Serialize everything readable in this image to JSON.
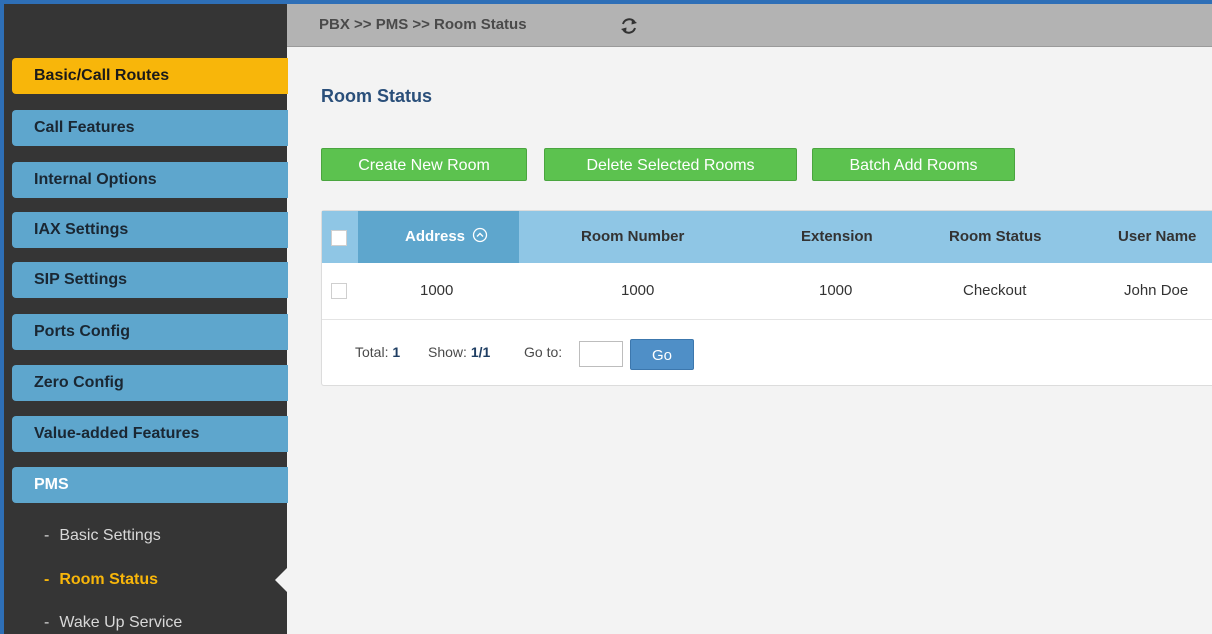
{
  "header": {
    "breadcrumb": "PBX >> PMS >> Room Status",
    "refresh_icon": "refresh-icon"
  },
  "sidebar": {
    "items": [
      {
        "label": "Basic/Call Routes",
        "state": "active"
      },
      {
        "label": "Call Features"
      },
      {
        "label": "Internal Options"
      },
      {
        "label": "IAX Settings"
      },
      {
        "label": "SIP Settings"
      },
      {
        "label": "Ports Config"
      },
      {
        "label": "Zero Config"
      },
      {
        "label": "Value-added Features"
      },
      {
        "label": "PMS",
        "state": "open"
      }
    ],
    "sub_items": [
      {
        "label": "Basic Settings"
      },
      {
        "label": "Room Status",
        "state": "current"
      },
      {
        "label": "Wake Up Service"
      }
    ],
    "sub_dash": "-"
  },
  "main": {
    "title": "Room Status",
    "buttons": {
      "create": "Create New Room",
      "delete": "Delete Selected Rooms",
      "batch": "Batch Add Rooms"
    },
    "table": {
      "columns": [
        "Address",
        "Room Number",
        "Extension",
        "Room Status",
        "User Name"
      ],
      "sorted_column": "Address",
      "rows": [
        [
          "1000",
          "1000",
          "1000",
          "Checkout",
          "John Doe"
        ]
      ]
    },
    "pagination": {
      "total_label": "Total:",
      "total_value": "1",
      "show_label": "Show:",
      "show_value": "1/1",
      "goto_label": "Go to:",
      "goto_value": "",
      "go_button": "Go"
    }
  },
  "colors": {
    "active_menu": "#f8b60a",
    "menu": "#5ea6cd",
    "green_button": "#5cc24f",
    "go_button": "#4f8fc7",
    "table_header": "#8fc6e5",
    "sorted_header": "#5ea6cd"
  }
}
